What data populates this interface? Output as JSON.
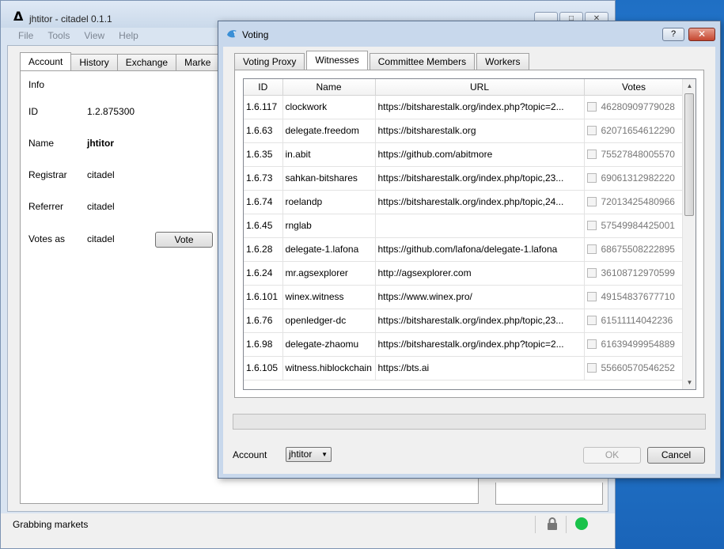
{
  "main_window": {
    "logo": "Δ",
    "title": "jhtitor - citadel 0.1.1",
    "menu": [
      "File",
      "Tools",
      "View",
      "Help"
    ],
    "tabs": [
      "Account",
      "History",
      "Exchange",
      "Marke"
    ],
    "account": {
      "info_label": "Info",
      "fields": [
        {
          "label": "ID",
          "value": "1.2.875300"
        },
        {
          "label": "Name",
          "value": "jhtitor"
        },
        {
          "label": "Registrar",
          "value": "citadel"
        },
        {
          "label": "Referrer",
          "value": "citadel"
        },
        {
          "label": "Votes as",
          "value": "citadel"
        }
      ],
      "vote_button": "Vote"
    },
    "status_text": "Grabbing markets",
    "status_color": "#19c24a"
  },
  "dialog": {
    "title": "Voting",
    "help_label": "?",
    "close_label": "✕",
    "tabs": [
      "Voting Proxy",
      "Witnesses",
      "Committee Members",
      "Workers"
    ],
    "table": {
      "columns": [
        "ID",
        "Name",
        "URL",
        "Votes"
      ],
      "rows": [
        {
          "id": "1.6.117",
          "name": "clockwork",
          "url": "https://bitsharestalk.org/index.php?topic=2...",
          "votes": "46280909779028"
        },
        {
          "id": "1.6.63",
          "name": "delegate.freedom",
          "url": "https://bitsharestalk.org",
          "votes": "62071654612290"
        },
        {
          "id": "1.6.35",
          "name": "in.abit",
          "url": "https://github.com/abitmore",
          "votes": "75527848005570"
        },
        {
          "id": "1.6.73",
          "name": "sahkan-bitshares",
          "url": "https://bitsharestalk.org/index.php/topic,23...",
          "votes": "69061312982220"
        },
        {
          "id": "1.6.74",
          "name": "roelandp",
          "url": "https://bitsharestalk.org/index.php/topic,24...",
          "votes": "72013425480966"
        },
        {
          "id": "1.6.45",
          "name": "rnglab",
          "url": "",
          "votes": "57549984425001"
        },
        {
          "id": "1.6.28",
          "name": "delegate-1.lafona",
          "url": "https://github.com/lafona/delegate-1.lafona",
          "votes": "68675508222895"
        },
        {
          "id": "1.6.24",
          "name": "mr.agsexplorer",
          "url": "http://agsexplorer.com",
          "votes": "36108712970599"
        },
        {
          "id": "1.6.101",
          "name": "winex.witness",
          "url": "https://www.winex.pro/",
          "votes": "49154837677710"
        },
        {
          "id": "1.6.76",
          "name": "openledger-dc",
          "url": "https://bitsharestalk.org/index.php/topic,23...",
          "votes": "61511114042236"
        },
        {
          "id": "1.6.98",
          "name": "delegate-zhaomu",
          "url": "https://bitsharestalk.org/index.php?topic=2...",
          "votes": "61639499954889"
        },
        {
          "id": "1.6.105",
          "name": "witness.hiblockchain",
          "url": "https://bts.ai",
          "votes": "55660570546252"
        }
      ]
    },
    "account_label": "Account",
    "account_value": "jhtitor",
    "ok_label": "OK",
    "cancel_label": "Cancel"
  }
}
